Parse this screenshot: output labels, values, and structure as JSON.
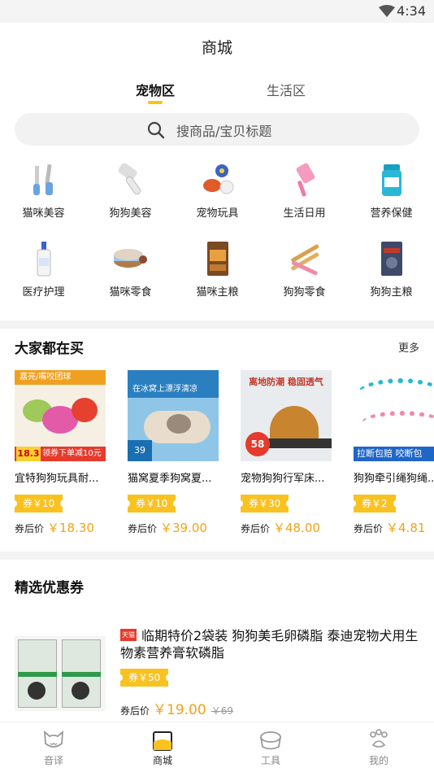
{
  "status": {
    "time": "4:34"
  },
  "header": {
    "title": "商城"
  },
  "tabs": [
    {
      "label": "宠物区"
    },
    {
      "label": "生活区"
    }
  ],
  "search": {
    "placeholder": "搜商品/宝贝标题"
  },
  "categories": [
    {
      "label": "猫咪美容",
      "icon": "grooming-tools-icon"
    },
    {
      "label": "狗狗美容",
      "icon": "grooming-brush-icon"
    },
    {
      "label": "宠物玩具",
      "icon": "toy-balls-icon"
    },
    {
      "label": "生活日用",
      "icon": "lint-roller-icon"
    },
    {
      "label": "营养保健",
      "icon": "supplement-jar-icon"
    },
    {
      "label": "医疗护理",
      "icon": "medicine-bottle-icon"
    },
    {
      "label": "猫咪零食",
      "icon": "cat-snack-can-icon"
    },
    {
      "label": "猫咪主粮",
      "icon": "cat-food-bag-icon"
    },
    {
      "label": "狗狗零食",
      "icon": "dog-chew-sticks-icon"
    },
    {
      "label": "狗狗主粮",
      "icon": "dog-food-bag-icon"
    }
  ],
  "popular": {
    "title": "大家都在买",
    "more": "更多",
    "after_label": "券后价",
    "items": [
      {
        "name": "宜特狗狗玩具耐...",
        "coupon": "券￥10",
        "price": "￥18.30",
        "banner": {
          "price": "18.3",
          "caption": "领券下单减10元",
          "headline": "嘉亮/嘴咬团球"
        }
      },
      {
        "name": "猫窝夏季狗窝夏...",
        "coupon": "券￥10",
        "price": "￥39.00",
        "banner": {
          "headline": "在冰窝上漂浮清凉",
          "price": "39"
        }
      },
      {
        "name": "宠物狗狗行军床...",
        "coupon": "券￥30",
        "price": "￥48.00",
        "banner": {
          "headline": "离地防潮 稳固透气",
          "price": "58"
        }
      },
      {
        "name": "狗狗牵引绳狗绳...",
        "coupon": "券￥2",
        "price": "￥4.81",
        "banner": {
          "headline": "拉断包赔 咬断包"
        }
      }
    ]
  },
  "selected": {
    "title": "精选优惠券",
    "item": {
      "badge": "天猫",
      "name": "临期特价2袋装 狗狗美毛卵磷脂 泰迪宠物犬用生物素营养膏软磷脂",
      "coupon": "券￥50",
      "after_label": "券后价",
      "price": "￥19.00",
      "original": "￥69"
    }
  },
  "bottom_nav": [
    {
      "label": "音译",
      "icon": "cat-face-icon"
    },
    {
      "label": "商城",
      "icon": "shopping-bag-icon"
    },
    {
      "label": "工具",
      "icon": "bowl-icon"
    },
    {
      "label": "我的",
      "icon": "paw-icon"
    }
  ],
  "colors": {
    "accent": "#f9c220",
    "price": "#f0a316",
    "tab_underline": "#f7c21a"
  }
}
